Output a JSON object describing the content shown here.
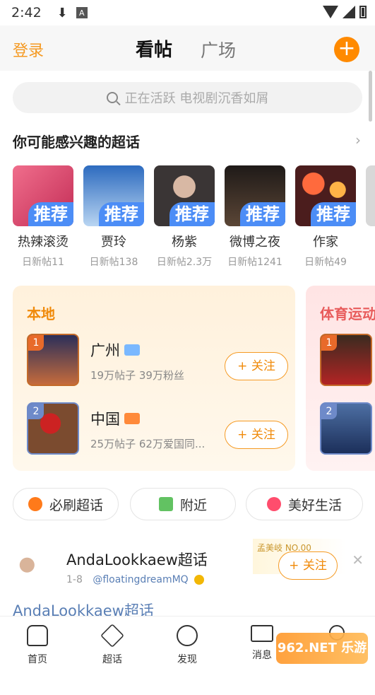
{
  "status_bar": {
    "time": "2:42",
    "download_icon": "download-icon",
    "notif_letter": "A"
  },
  "header": {
    "login": "登录",
    "tabs": [
      "看帖",
      "广场"
    ],
    "active_tab": "看帖",
    "add_icon": "plus-icon"
  },
  "search": {
    "placeholder": "正在活跃 电视剧沉香如屑"
  },
  "interest": {
    "title": "你可能感兴趣的超话",
    "cards": [
      {
        "name": "热辣滚烫",
        "tag": "推荐",
        "sub": "日新帖11",
        "color": "#d43c64"
      },
      {
        "name": "贾玲",
        "tag": "推荐",
        "sub": "日新帖138",
        "color": "#8fb6e3"
      },
      {
        "name": "杨紫",
        "tag": "推荐",
        "sub": "日新帖2.3万",
        "color": "#3a3535"
      },
      {
        "name": "微博之夜",
        "tag": "推荐",
        "sub": "日新帖1241",
        "color": "#2b2320"
      },
      {
        "name": "作家",
        "tag": "推荐",
        "sub": "日新帖49",
        "color": "#4b1d1d"
      }
    ]
  },
  "local": {
    "title": "本地",
    "items": [
      {
        "rank": "1",
        "name": "广州",
        "info": "19万帖子 39万粉丝",
        "follow": "+ 关注",
        "rank_color": "#e86a2a",
        "badge_color": "#7ab8ff"
      },
      {
        "rank": "2",
        "name": "中国",
        "info": "25万帖子 62万爱国同...",
        "follow": "+ 关注",
        "rank_color": "#6e8ac9",
        "badge_color": "#ff8a3a"
      }
    ]
  },
  "sport": {
    "title": "体育运动",
    "items": [
      {
        "rank": "1"
      },
      {
        "rank": "2"
      }
    ]
  },
  "chips": [
    {
      "label": "必刷超话",
      "icon": "flame-icon",
      "color": "#ff7a1a"
    },
    {
      "label": "附近",
      "icon": "building-icon",
      "color": "#62c262"
    },
    {
      "label": "美好生活",
      "icon": "heart-icon",
      "color": "#ff4d6d"
    }
  ],
  "post": {
    "name": "AndaLookkaew超话",
    "meta": "1-8",
    "handle": "@floatingdreamMQ",
    "promo": "孟美岐 NO.00",
    "follow": "+ 关注",
    "close": "✕",
    "topic": "AndaLookkaew超话"
  },
  "bottom_nav": [
    {
      "label": "首页"
    },
    {
      "label": "超话"
    },
    {
      "label": "发现"
    },
    {
      "label": "消息"
    },
    {
      "label": ""
    }
  ],
  "watermark": "962.NET 乐游网"
}
